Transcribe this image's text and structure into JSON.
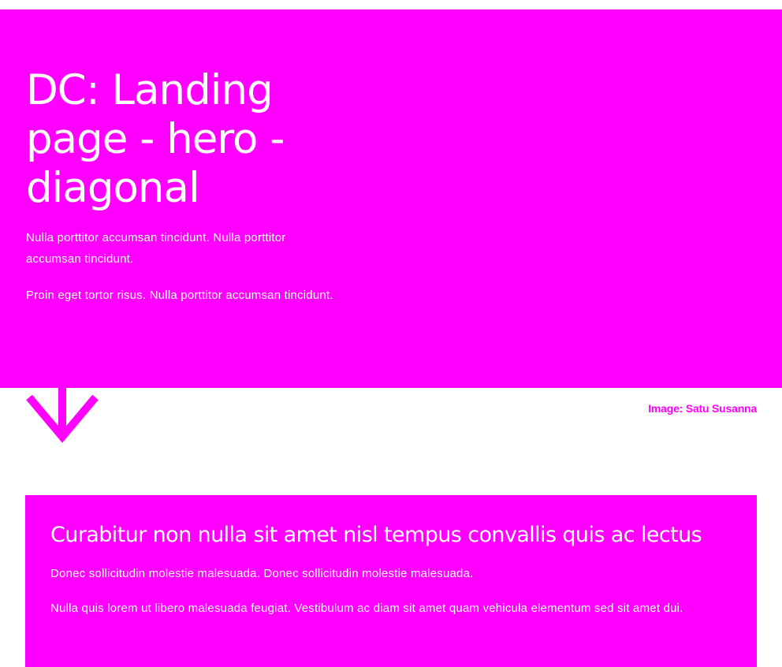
{
  "colors": {
    "accent": "#ff00ff",
    "text_on_accent": "#ffffff",
    "background": "#ffffff"
  },
  "hero": {
    "title": "DC: Landing page - hero - diagonal",
    "paragraphs": [
      "Nulla porttitor accumsan tincidunt. Nulla porttitor accumsan tincidunt.",
      "Proin eget tortor risus. Nulla porttitor accumsan tincidunt."
    ],
    "scroll_icon": "arrow-down-icon"
  },
  "image_credit": "Image: Satu Susanna",
  "content_card": {
    "title": "Curabitur non nulla sit amet nisl tempus convallis quis ac lectus",
    "paragraphs": [
      "Donec sollicitudin molestie malesuada. Donec sollicitudin molestie malesuada.",
      "Nulla quis lorem ut libero malesuada feugiat. Vestibulum ac diam sit amet quam vehicula elementum sed sit amet dui."
    ]
  }
}
